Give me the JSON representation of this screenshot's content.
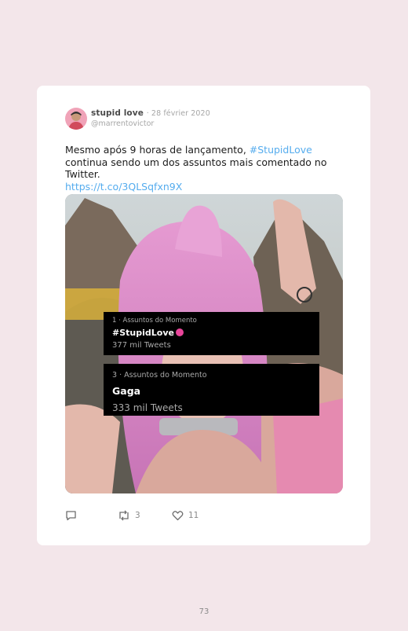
{
  "tweet": {
    "display_name": "stupid love",
    "date": "· 28 février 2020",
    "handle": "@marrentovictor",
    "text_before": "Mesmo após 9 horas de lançamento, ",
    "hashtag": "#StupidLove",
    "text_after": " continua sendo um dos assuntos mais comentado no Twitter.",
    "link": "https://t.co/3QLSqfxn9X"
  },
  "media": {
    "trends": [
      {
        "category": "1 · Assuntos do Momento",
        "tag": "#StupidLove",
        "count": "377 mil Tweets"
      },
      {
        "category": "3 · Assuntos do Momento",
        "tag": "Gaga",
        "count": "333 mil Tweets"
      }
    ]
  },
  "actions": {
    "reply_count": "",
    "retweet_count": "3",
    "like_count": "11"
  },
  "page": {
    "number": "73"
  },
  "colors": {
    "background": "#f3e6ea",
    "link": "#55acee",
    "accent_pink": "#e8459a"
  }
}
